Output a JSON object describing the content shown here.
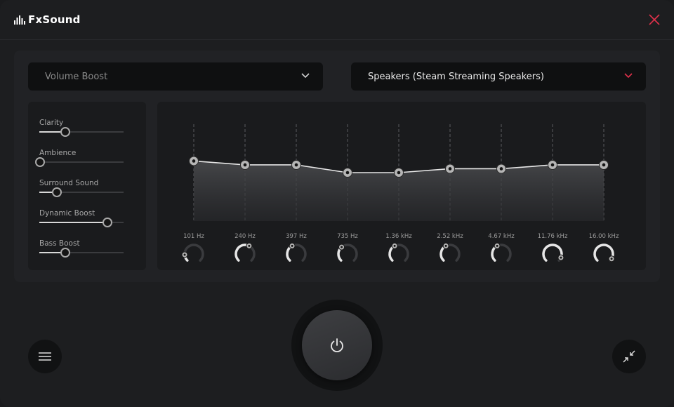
{
  "app": {
    "name": "FxSound"
  },
  "presets": {
    "selected": "Volume Boost"
  },
  "output": {
    "selected": "Speakers (Steam Streaming Speakers)"
  },
  "effects": [
    {
      "label": "Clarity",
      "value": 0.3
    },
    {
      "label": "Ambience",
      "value": 0.0
    },
    {
      "label": "Surround Sound",
      "value": 0.2
    },
    {
      "label": "Dynamic Boost",
      "value": 0.8
    },
    {
      "label": "Bass Boost",
      "value": 0.3
    }
  ],
  "equalizer": {
    "bands": [
      {
        "freq": "101 Hz",
        "level": 0.62,
        "knob": 0.15
      },
      {
        "freq": "240 Hz",
        "level": 0.58,
        "knob": 0.6
      },
      {
        "freq": "397 Hz",
        "level": 0.58,
        "knob": 0.4
      },
      {
        "freq": "735 Hz",
        "level": 0.5,
        "knob": 0.35
      },
      {
        "freq": "1.36 kHz",
        "level": 0.5,
        "knob": 0.4
      },
      {
        "freq": "2.52 kHz",
        "level": 0.54,
        "knob": 0.4
      },
      {
        "freq": "4.67 kHz",
        "level": 0.54,
        "knob": 0.4
      },
      {
        "freq": "11.76 kHz",
        "level": 0.58,
        "knob": 0.92
      },
      {
        "freq": "16.00 kHz",
        "level": 0.58,
        "knob": 0.95
      }
    ]
  },
  "colors": {
    "accent": "#e0314b",
    "knob_fill": "#e6e6e6",
    "track": "#3a3b3e"
  },
  "icons": {
    "logo": "bars-logo-icon",
    "close": "close-icon",
    "chevron": "chevron-down-icon",
    "power": "power-icon",
    "menu": "hamburger-menu-icon",
    "compact": "compact-view-icon"
  }
}
